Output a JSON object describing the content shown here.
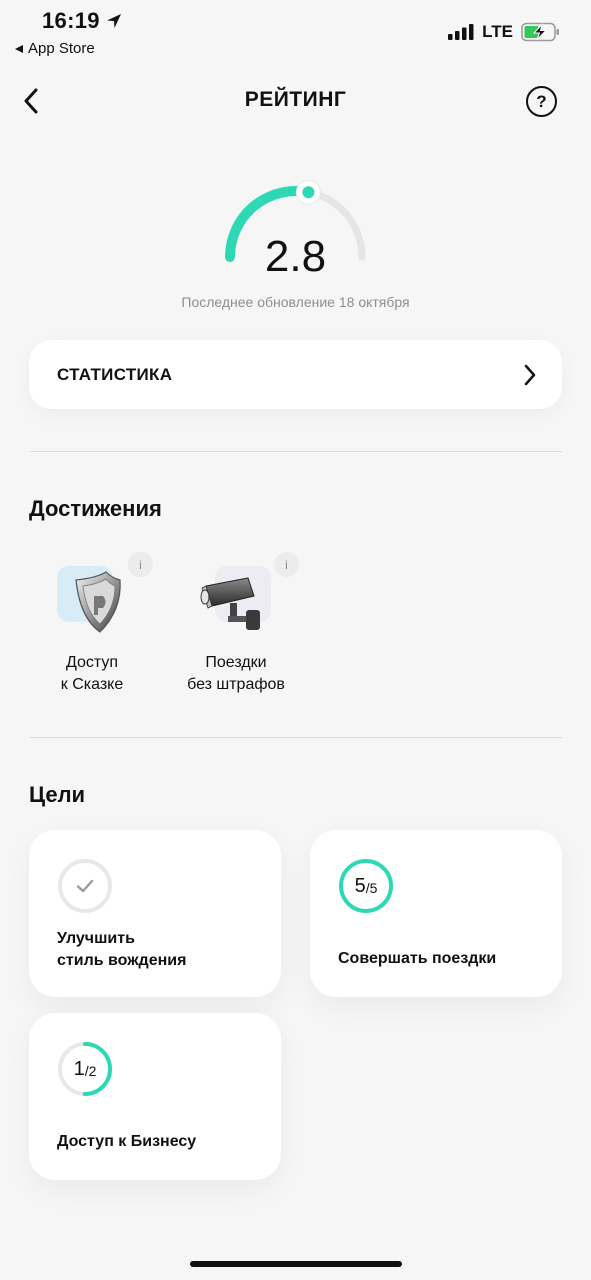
{
  "status_bar": {
    "time": "16:19",
    "back_app": "App Store",
    "network": "LTE"
  },
  "header": {
    "title": "РЕЙТИНГ",
    "help_symbol": "?"
  },
  "rating": {
    "value": "2.8",
    "updated": "Последнее обновление 18 октября",
    "gauge_fraction": 0.56,
    "accent_color": "#2fd8b4"
  },
  "stats": {
    "label": "СТАТИСТИКА"
  },
  "achievements": {
    "title": "Достижения",
    "items": [
      {
        "line1": "Доступ",
        "line2": "к Сказке",
        "icon": "shield-icon",
        "info": "i"
      },
      {
        "line1": "Поездки",
        "line2": "без штрафов",
        "icon": "camera-icon",
        "info": "i"
      }
    ]
  },
  "goals": {
    "title": "Цели",
    "items": [
      {
        "line1": "Улучшить",
        "line2": "стиль вождения",
        "status": "done",
        "icon": "check-icon"
      },
      {
        "line1": "Совершать поездки",
        "current": "5",
        "total": "/5",
        "progress": 1.0
      },
      {
        "line1": "Доступ к Бизнесу",
        "current": "1",
        "total": "/2",
        "progress": 0.5
      }
    ]
  }
}
